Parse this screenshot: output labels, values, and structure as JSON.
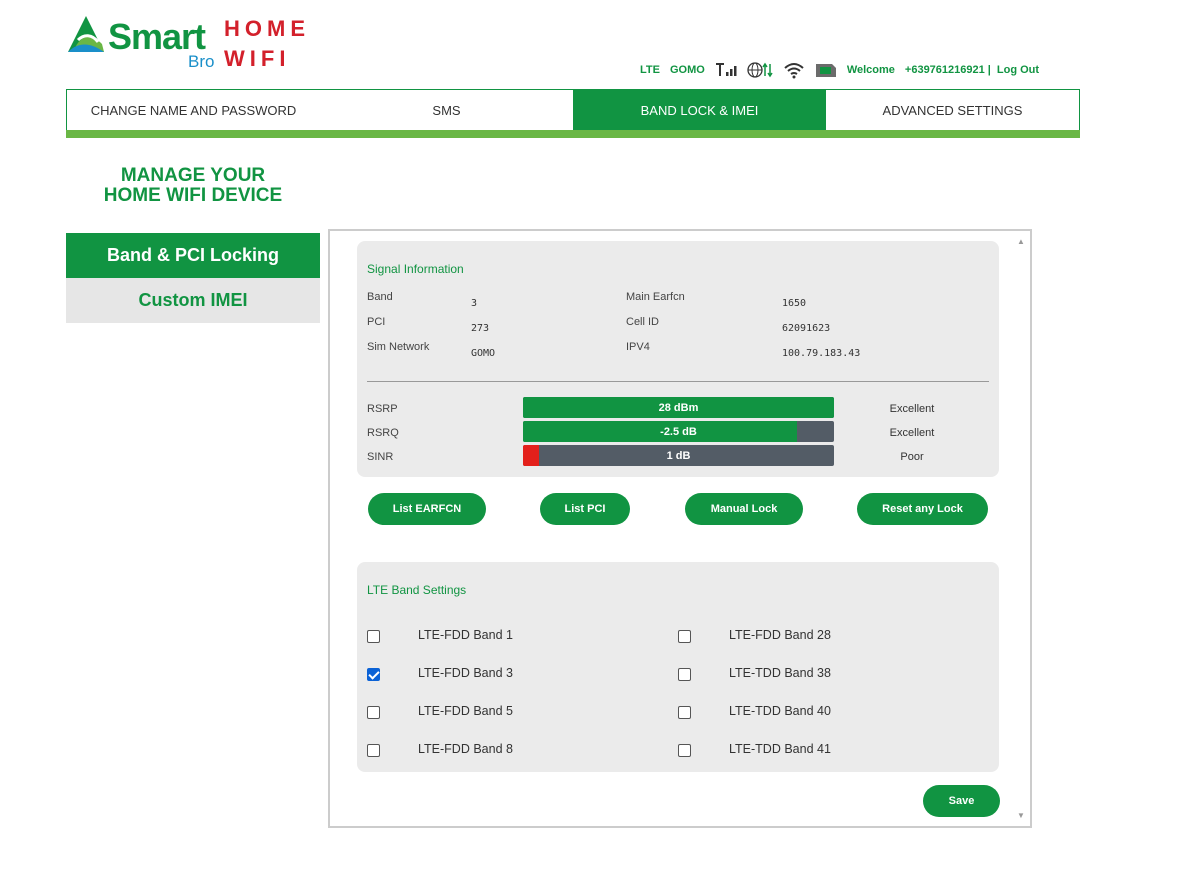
{
  "brand": {
    "smart": "Smart",
    "bro": "Bro",
    "home": "HOME",
    "wifi": "WIFI",
    "green": "#119442",
    "red": "#d3202b"
  },
  "status_bar": {
    "network_type": "LTE",
    "operator": "GOMO",
    "icons": [
      "signal-bars-icon",
      "globe-updown-icon",
      "wifi-icon",
      "sim-card-icon"
    ],
    "welcome": "Welcome",
    "phone": "+639761216921 |",
    "logout": "Log Out"
  },
  "tabs": [
    {
      "label": "CHANGE NAME AND PASSWORD",
      "active": false
    },
    {
      "label": "SMS",
      "active": false
    },
    {
      "label": "BAND LOCK & IMEI",
      "active": true
    },
    {
      "label": "ADVANCED SETTINGS",
      "active": false
    }
  ],
  "manage_title": {
    "line1": "MANAGE YOUR",
    "line2": "HOME WIFI DEVICE"
  },
  "side_menu": [
    {
      "label": "Band & PCI Locking",
      "active": true
    },
    {
      "label": "Custom IMEI",
      "active": false
    }
  ],
  "signal_info": {
    "title": "Signal Information",
    "band_label": "Band",
    "band_value": "3",
    "pci_label": "PCI",
    "pci_value": "273",
    "sim_label": "Sim Network",
    "sim_value": "GOMO",
    "earfcn_label": "Main Earfcn",
    "earfcn_value": "1650",
    "cellid_label": "Cell ID",
    "cellid_value": "62091623",
    "ipv4_label": "IPV4",
    "ipv4_value": "100.79.183.43",
    "meters": [
      {
        "label": "RSRP",
        "value_text": "28 dBm",
        "fill_fraction": 1.0,
        "fill_color": "#119442",
        "quality": "Excellent"
      },
      {
        "label": "RSRQ",
        "value_text": "-2.5 dB",
        "fill_fraction": 0.88,
        "fill_color": "#119442",
        "quality": "Excellent"
      },
      {
        "label": "SINR",
        "value_text": "1 dB",
        "fill_fraction": 0.05,
        "fill_color": "#e3201b",
        "quality": "Poor"
      }
    ]
  },
  "actions": {
    "list_earfcn": "List EARFCN",
    "list_pci": "List PCI",
    "manual_lock": "Manual Lock",
    "reset_lock": "Reset any Lock"
  },
  "lte_bands": {
    "title": "LTE Band Settings",
    "left": [
      {
        "label": "LTE-FDD Band 1",
        "checked": false
      },
      {
        "label": "LTE-FDD Band 3",
        "checked": true
      },
      {
        "label": "LTE-FDD Band 5",
        "checked": false
      },
      {
        "label": "LTE-FDD Band 8",
        "checked": false
      }
    ],
    "right": [
      {
        "label": "LTE-FDD Band 28",
        "checked": false
      },
      {
        "label": "LTE-TDD Band 38",
        "checked": false
      },
      {
        "label": "LTE-TDD Band 40",
        "checked": false
      },
      {
        "label": "LTE-TDD Band 41",
        "checked": false
      }
    ]
  },
  "save_label": "Save"
}
